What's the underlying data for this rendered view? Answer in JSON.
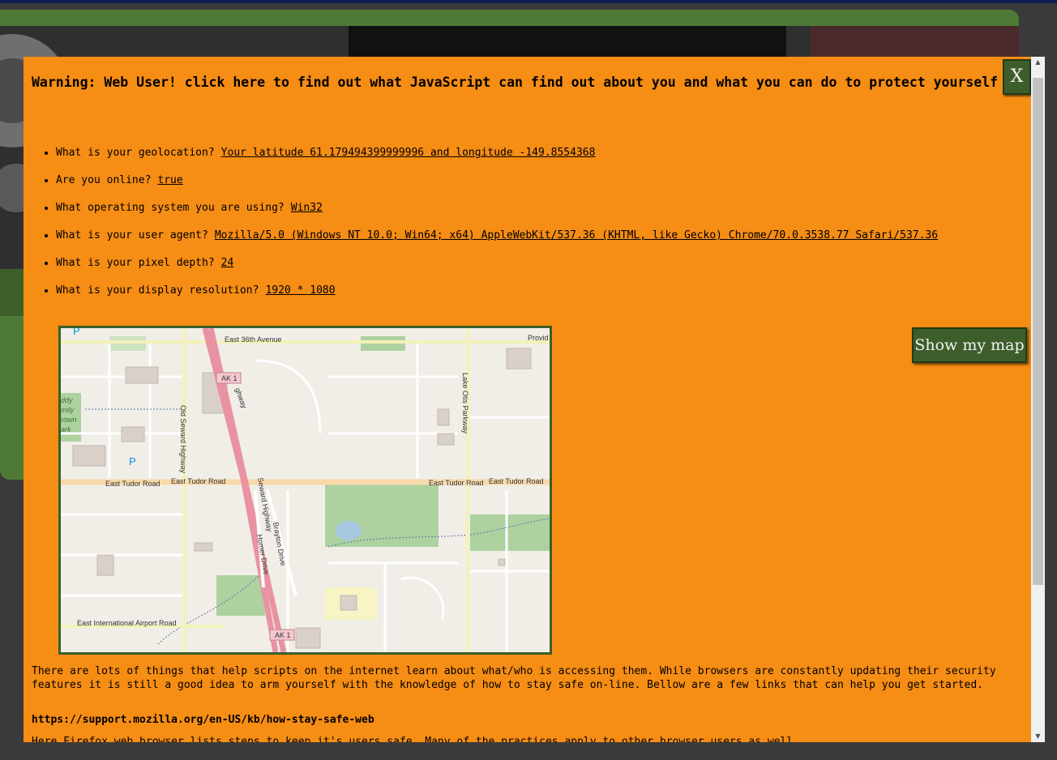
{
  "modal": {
    "warning_title": "Warning: Web User! click here to find out what JavaScript can find out about you and what you can do to protect yourself",
    "close_label": "X",
    "info_items": [
      {
        "label": "What is your geolocation?",
        "value": "Your latitude 61.179494399999996 and longitude -149.8554368"
      },
      {
        "label": "Are you online?",
        "value": "true"
      },
      {
        "label": "What operating system you are using?",
        "value": "Win32"
      },
      {
        "label": "What is your user agent?",
        "value": "Mozilla/5.0 (Windows NT 10.0; Win64; x64) AppleWebKit/537.36 (KHTML, like Gecko) Chrome/70.0.3538.77 Safari/537.36"
      },
      {
        "label": "What is your pixel depth?",
        "value": "24"
      },
      {
        "label": "What is your display resolution?",
        "value": "1920 * 1080"
      }
    ],
    "map_button_label": "Show my map",
    "paragraph": "There are lots of things that help scripts on the internet learn about what/who is accessing them. While browsers are constantly updating their security features it is still a good idea to arm yourself with the knowledge of how to stay safe on-line. Bellow are a few links that can help you get started.",
    "link_url": "https://support.mozilla.org/en-US/kb/how-stay-safe-web",
    "link_description_partial": "Here Firefox web browser lists steps to keep it's users safe. Many of the practices apply to other browser users as well."
  },
  "map": {
    "labels": {
      "east_36th": "East 36th Avenue",
      "provid": "Provid",
      "ak1_top": "AK 1",
      "highway_top": "ghway",
      "old_seward": "Old Seward Highway",
      "lake_otis": "Lake Otis Parkway",
      "tudor_1": "East Tudor Road",
      "tudor_2": "East Tudor Road",
      "tudor_3": "East Tudor Road",
      "tudor_4": "East Tudor Road",
      "seward_highway": "Seward Highway",
      "brayton": "Brayton Drive",
      "homer": "Homer Drive",
      "intl_airport": "East International Airport Road",
      "ak1_bottom": "AK 1",
      "park_1": "ddy",
      "park_2": "mily",
      "park_3": "rown",
      "park_4": "ark",
      "parking_1": "P",
      "parking_2": "P"
    }
  },
  "scrollbar": {
    "up_arrow": "▲",
    "down_arrow": "▼"
  },
  "colors": {
    "modal_background": "#f68d14",
    "button_green": "#3d5e2b",
    "page_green": "#4e7a35"
  }
}
